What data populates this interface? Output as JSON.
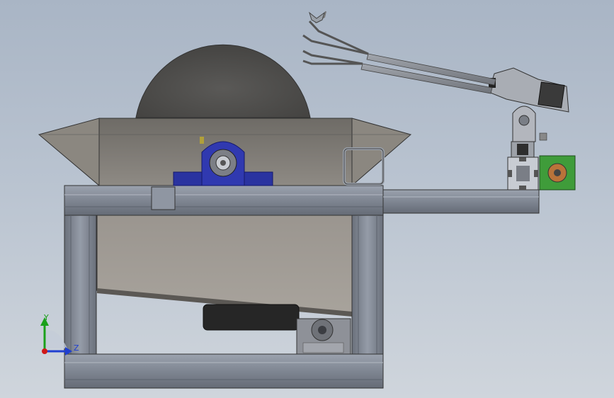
{
  "viewport": {
    "background_top": "#a9b5c5",
    "background_bottom": "#cfd5dc"
  },
  "model": {
    "parts": [
      "sanding-disc",
      "hopper",
      "pillow-block-bearing",
      "square-tube-handle",
      "frame",
      "motor",
      "worm-gearbox",
      "aluminum-extrusion",
      "stepper-motor",
      "robot-arm",
      "gripper"
    ],
    "colors": {
      "frame": "#7e8593",
      "hopper": "#6f6c66",
      "bearing": "#2f37a8",
      "disc": "#4e4d4b",
      "motor": "#2a2a2a",
      "stepper": "#3f9c3a",
      "arm": "#8c8f96"
    }
  },
  "triad": {
    "y_label": "Y",
    "z_label": "Z",
    "colors": {
      "y": "#1aa01a",
      "z": "#1f3fd0",
      "origin": "#d01818"
    }
  }
}
